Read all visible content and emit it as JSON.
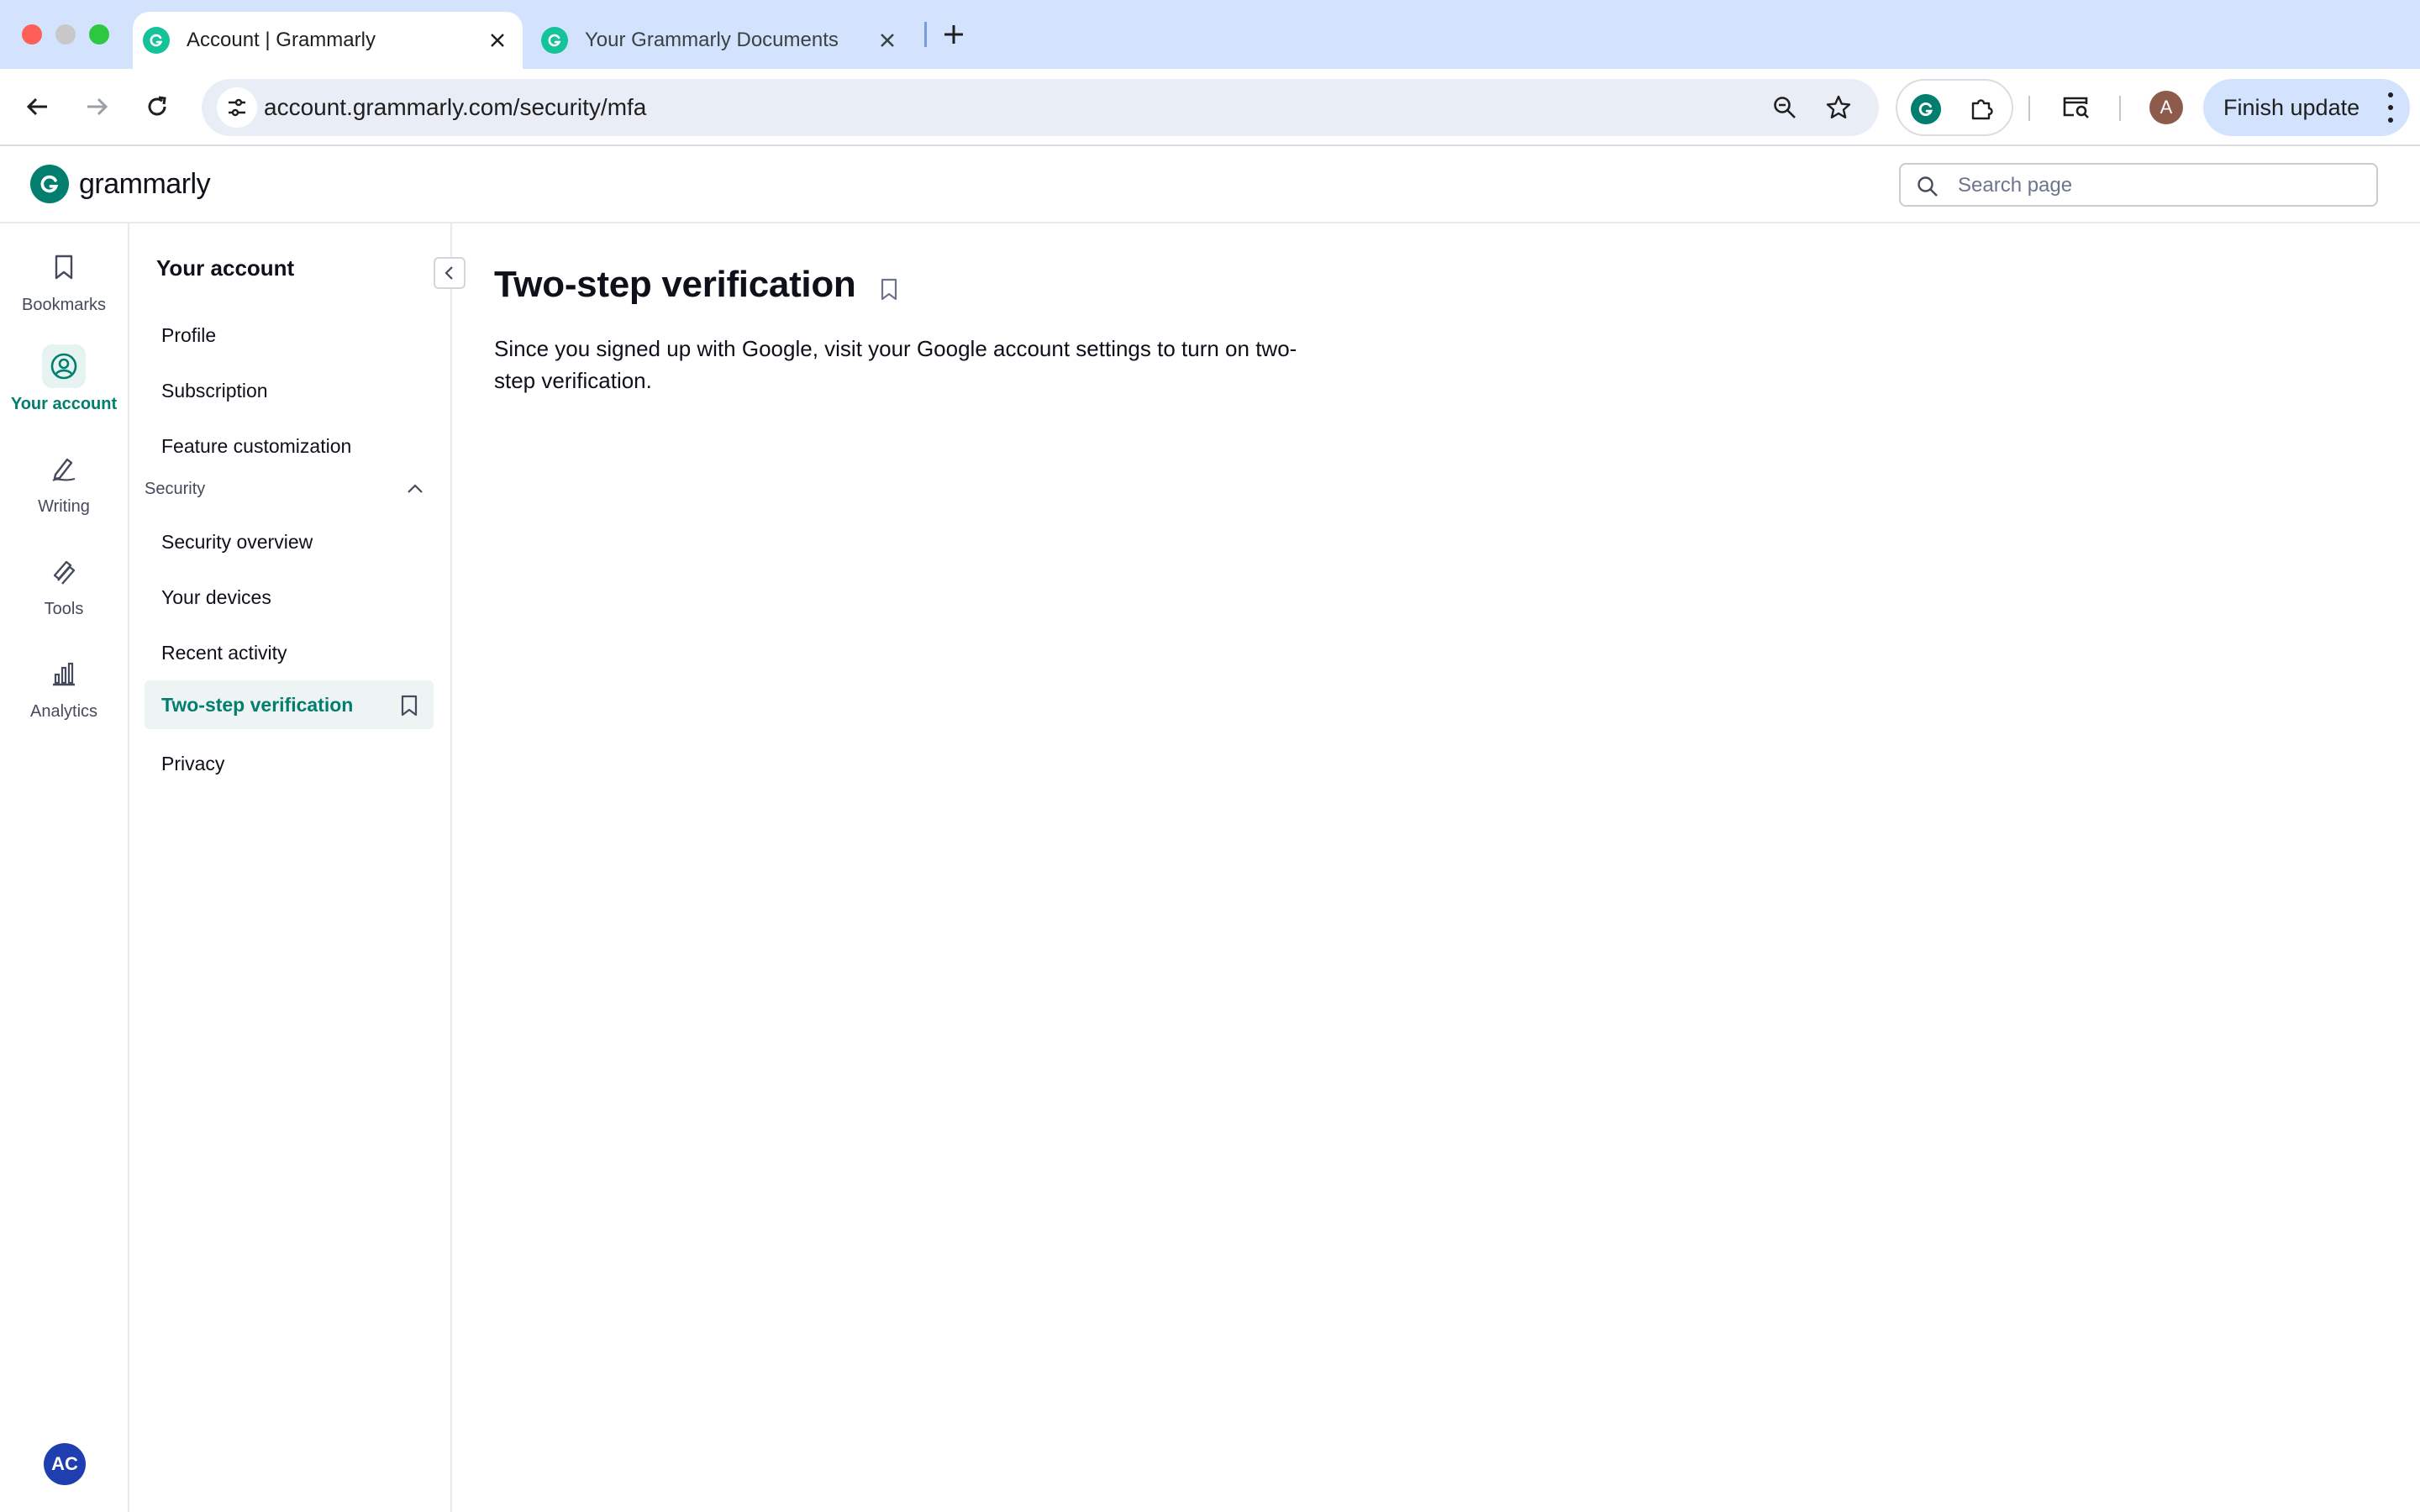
{
  "browser": {
    "tabs": [
      {
        "title": "Account | Grammarly",
        "active": true
      },
      {
        "title": "Your Grammarly Documents",
        "active": false
      }
    ],
    "url": "account.grammarly.com/security/mfa",
    "profile_initial": "A",
    "finish_update_label": "Finish update"
  },
  "header": {
    "logo_text": "grammarly",
    "search_placeholder": "Search page"
  },
  "rail": {
    "items": [
      {
        "label": "Bookmarks",
        "icon": "bookmark-icon"
      },
      {
        "label": "Your account",
        "icon": "account-icon",
        "active": true
      },
      {
        "label": "Writing",
        "icon": "pen-icon"
      },
      {
        "label": "Tools",
        "icon": "tools-icon"
      },
      {
        "label": "Analytics",
        "icon": "analytics-icon"
      }
    ],
    "user_initials": "AC"
  },
  "sidenav": {
    "title": "Your account",
    "items_top": [
      {
        "label": "Profile"
      },
      {
        "label": "Subscription"
      },
      {
        "label": "Feature customization"
      }
    ],
    "section_label": "Security",
    "items_security": [
      {
        "label": "Security overview"
      },
      {
        "label": "Your devices"
      },
      {
        "label": "Recent activity"
      },
      {
        "label": "Two-step verification",
        "active": true
      }
    ],
    "items_bottom": [
      {
        "label": "Privacy"
      }
    ]
  },
  "main": {
    "title": "Two-step verification",
    "description": "Since you signed up with Google, visit your Google account settings to turn on two-step verification."
  },
  "colors": {
    "brand_green": "#027e6f",
    "tab_strip": "#d3e3fd",
    "active_nav_bg": "#eef4f3"
  }
}
